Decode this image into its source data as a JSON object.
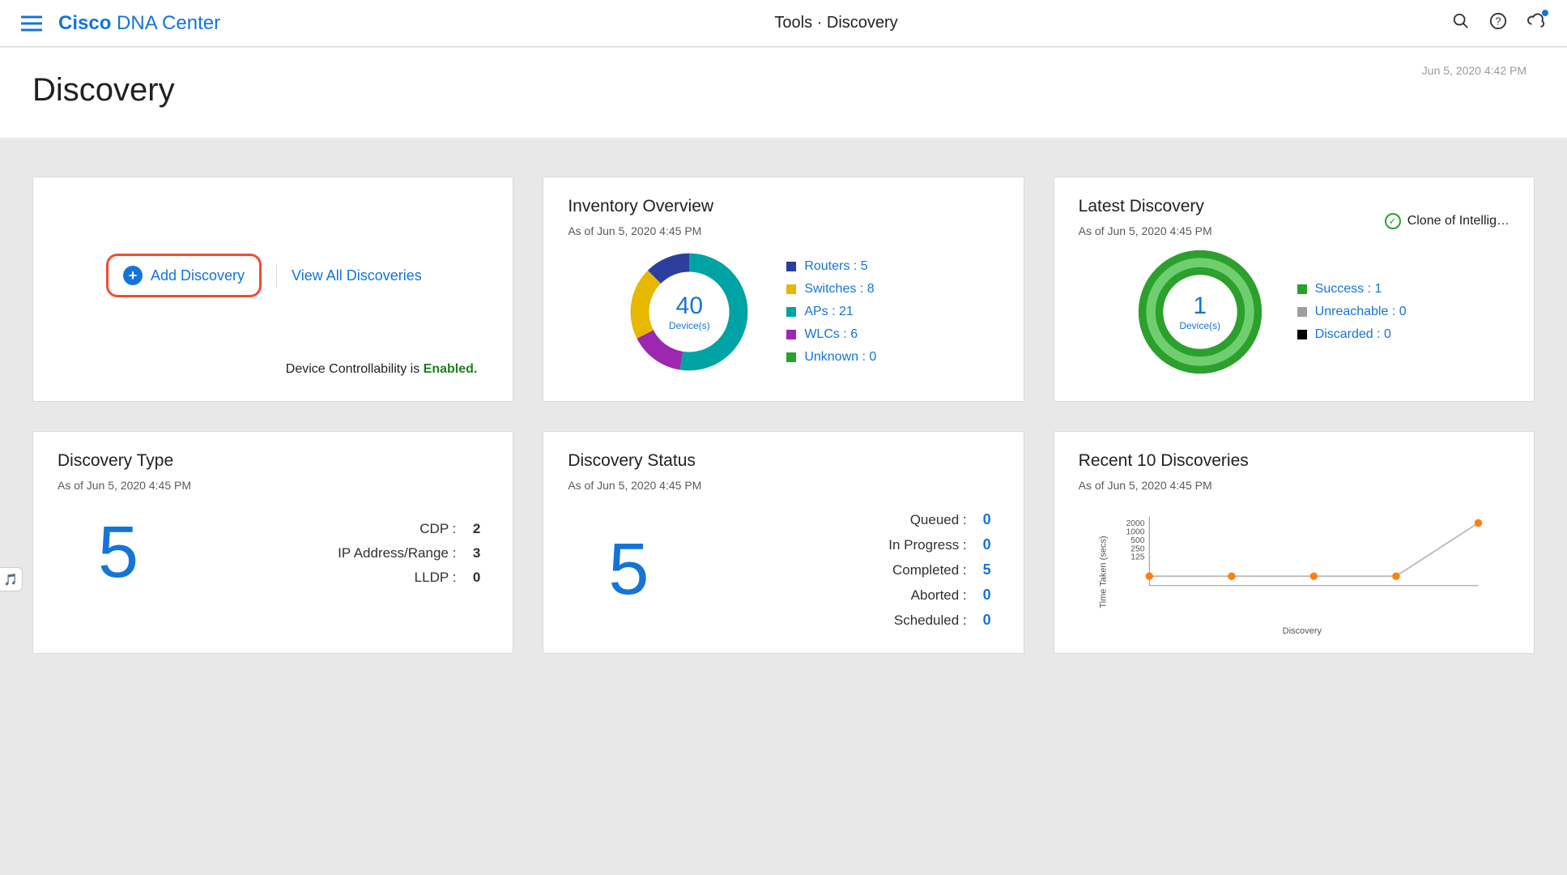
{
  "header": {
    "brand_bold": "Cisco",
    "brand_light": "DNA Center",
    "breadcrumb": "Tools · Discovery"
  },
  "page": {
    "title": "Discovery",
    "timestamp": "Jun 5, 2020 4:42 PM"
  },
  "actions_card": {
    "add_label": "Add Discovery",
    "view_all_label": "View All Discoveries",
    "controllability_prefix": "Device Controllability is ",
    "controllability_state": "Enabled."
  },
  "inventory": {
    "title": "Inventory Overview",
    "asof": "As of Jun 5, 2020 4:45 PM",
    "total": "40",
    "total_label": "Device(s)",
    "legend": [
      {
        "label": "Routers : 5",
        "color": "#2c3e9e",
        "value": 5
      },
      {
        "label": "Switches : 8",
        "color": "#e6b800",
        "value": 8
      },
      {
        "label": "APs : 21",
        "color": "#00a3a3",
        "value": 21
      },
      {
        "label": "WLCs : 6",
        "color": "#9c27b0",
        "value": 6
      },
      {
        "label": "Unknown : 0",
        "color": "#2ca02c",
        "value": 0
      }
    ]
  },
  "latest": {
    "title": "Latest Discovery",
    "asof": "As of Jun 5, 2020 4:45 PM",
    "chip_name": "Clone of Intellig…",
    "total": "1",
    "total_label": "Device(s)",
    "legend": [
      {
        "label": "Success : 1",
        "color": "#2ca02c"
      },
      {
        "label": "Unreachable : 0",
        "color": "#9e9e9e"
      },
      {
        "label": "Discarded : 0",
        "color": "#000000"
      }
    ]
  },
  "disc_type": {
    "title": "Discovery Type",
    "asof": "As of Jun 5, 2020 4:45 PM",
    "total": "5",
    "rows": [
      {
        "k": "CDP :",
        "v": "2"
      },
      {
        "k": "IP Address/Range :",
        "v": "3"
      },
      {
        "k": "LLDP :",
        "v": "0"
      }
    ]
  },
  "disc_status": {
    "title": "Discovery Status",
    "asof": "As of Jun 5, 2020 4:45 PM",
    "total": "5",
    "rows": [
      {
        "k": "Queued :",
        "v": "0",
        "link": true
      },
      {
        "k": "In Progress :",
        "v": "0",
        "link": true
      },
      {
        "k": "Completed :",
        "v": "5",
        "link": true
      },
      {
        "k": "Aborted :",
        "v": "0",
        "link": true
      },
      {
        "k": "Scheduled :",
        "v": "0",
        "link": true
      }
    ]
  },
  "recent": {
    "title": "Recent 10 Discoveries",
    "asof": "As of Jun 5, 2020 4:45 PM",
    "ylabel": "Time Taken (secs)",
    "xlabel": "Discovery",
    "yticks": [
      "2000",
      "1000",
      "500",
      "250",
      "125"
    ]
  },
  "chart_data": [
    {
      "type": "pie",
      "title": "Inventory Overview",
      "categories": [
        "Routers",
        "Switches",
        "APs",
        "WLCs",
        "Unknown"
      ],
      "values": [
        5,
        8,
        21,
        6,
        0
      ],
      "total": 40
    },
    {
      "type": "pie",
      "title": "Latest Discovery",
      "categories": [
        "Success",
        "Unreachable",
        "Discarded"
      ],
      "values": [
        1,
        0,
        0
      ],
      "total": 1
    },
    {
      "type": "line",
      "title": "Recent 10 Discoveries",
      "xlabel": "Discovery",
      "ylabel": "Time Taken (secs)",
      "x": [
        1,
        2,
        3,
        4,
        5
      ],
      "values": [
        300,
        300,
        300,
        300,
        2000
      ],
      "ylim": [
        0,
        2200
      ]
    }
  ]
}
